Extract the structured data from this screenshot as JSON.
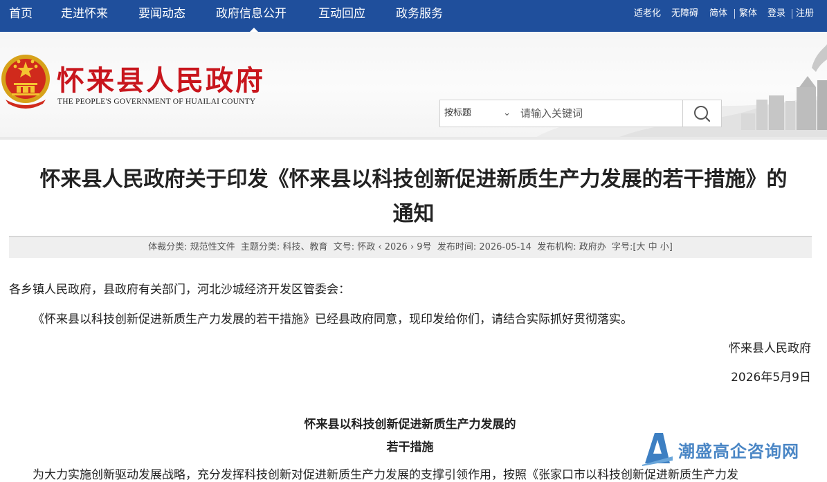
{
  "nav": {
    "items": [
      "首页",
      "走进怀来",
      "要闻动态",
      "政府信息公开",
      "互动回应",
      "政务服务"
    ],
    "active_index": 3
  },
  "util_links": [
    "适老化",
    "无障碍",
    "简体",
    "繁体",
    "登录",
    "注册"
  ],
  "header": {
    "title": "怀来县人民政府",
    "subtitle": "THE PEOPLE'S GOVERNMENT OF HUAILAI COUNTY"
  },
  "search": {
    "scope": "按标题",
    "placeholder": "请输入关键词"
  },
  "colors": {
    "nav_bg": "#1f4f9c",
    "title_red": "#c8161d",
    "watermark": "#4a86c5"
  },
  "article": {
    "title_line1": "怀来县人民政府关于印发《怀来县以科技创新促进新质生产力发展的若干措施》的",
    "title_line2": "通知",
    "meta": {
      "category_label": "体裁分类:",
      "category": "规范性文件",
      "topic_label": "主题分类:",
      "topic": "科技、教育",
      "doc_no_label": "文号:",
      "doc_no": "怀政 ‹ 2026 › 9号",
      "date_label": "发布时间:",
      "date": "2026-05-14",
      "org_label": "发布机构:",
      "org": "政府办",
      "font_label": "字号:",
      "font_open": "[",
      "font_large": "大",
      "font_medium": "中",
      "font_small": "小",
      "font_close": "]"
    },
    "salutation": "各乡镇人民政府，县政府有关部门，河北沙城经济开发区管委会：",
    "body": "《怀来县以科技创新促进新质生产力发展的若干措施》已经县政府同意，现印发给你们，请结合实际抓好贯彻落实。",
    "signature": "怀来县人民政府",
    "sign_date": "2026年5月9日",
    "attachment_title_line1": "怀来县以科技创新促进新质生产力发展的",
    "attachment_title_line2": "若干措施",
    "partial_line": "为大力实施创新驱动发展战略，充分发挥科技创新对促进新质生产力发展的支撑引领作用，按照《张家口市以科技创新促进新质生产力发"
  },
  "watermark": {
    "text": "潮盛高企咨询网"
  },
  "icons": {
    "search": "search-icon",
    "emblem": "national-emblem-icon",
    "chevron": "chevron-down-icon",
    "watermark_logo": "watermark-logo-icon"
  }
}
